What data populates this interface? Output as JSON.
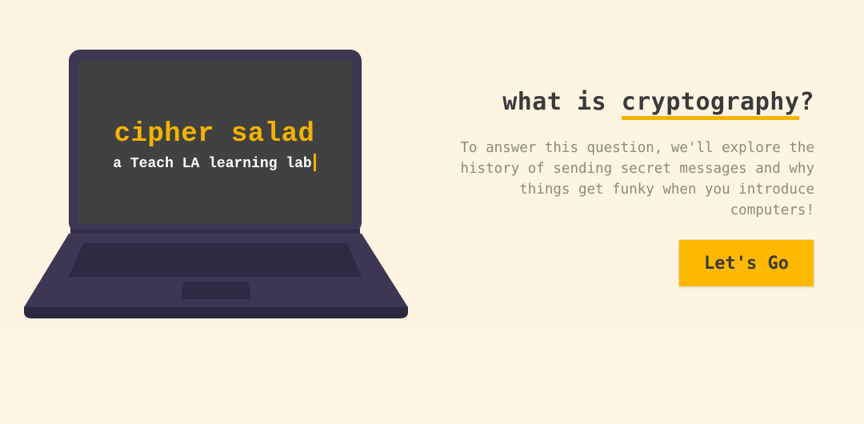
{
  "laptop": {
    "title": "cipher salad",
    "subtitle": "a Teach LA learning lab"
  },
  "intro": {
    "heading_prefix": "what is ",
    "heading_highlight": "cryptography",
    "heading_suffix": "?",
    "description": "To answer this question, we'll explore the history of sending secret messages and why things get funky when you introduce computers!",
    "cta_label": "Let's Go"
  },
  "colors": {
    "background": "#fdf6e2",
    "accent": "#ffb800",
    "laptop_body": "#3d3753",
    "screen": "#414141",
    "heading_text": "#3a3a3a"
  }
}
